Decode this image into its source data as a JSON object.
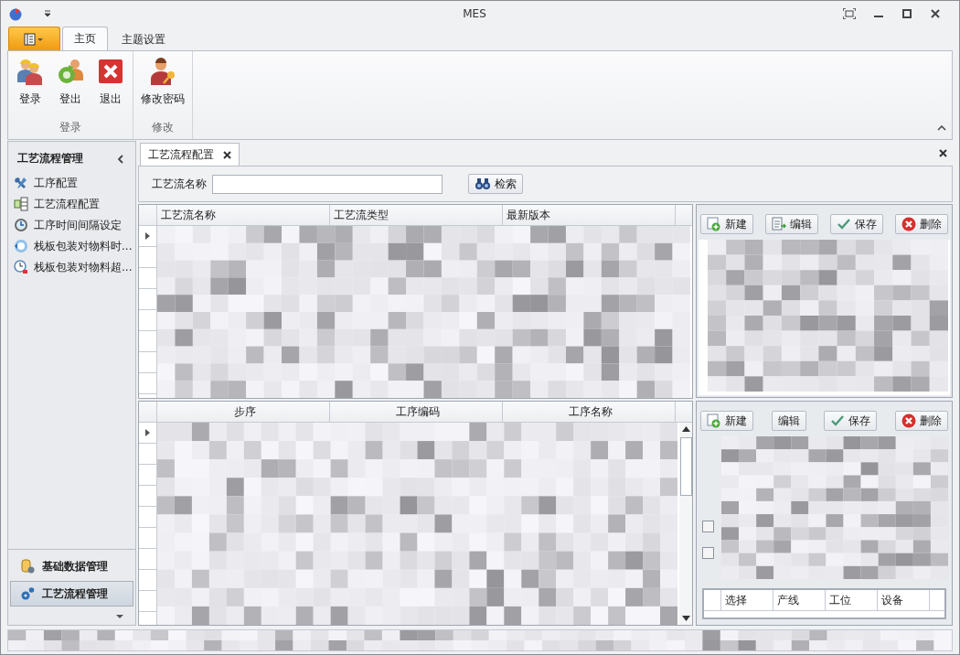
{
  "window": {
    "title": "MES"
  },
  "ribbon": {
    "tabs": [
      {
        "label": "主页",
        "selected": true
      },
      {
        "label": "主题设置",
        "selected": false
      }
    ],
    "groups": [
      {
        "label": "登录",
        "buttons": [
          {
            "label": "登录",
            "kind": "workers"
          },
          {
            "label": "登出",
            "kind": "logout"
          },
          {
            "label": "退出",
            "kind": "exit"
          }
        ]
      },
      {
        "label": "修改",
        "buttons": [
          {
            "label": "修改密码",
            "kind": "key"
          }
        ]
      }
    ]
  },
  "sidebar": {
    "title": "工艺流程管理",
    "items": [
      {
        "label": "工序配置",
        "kind": "tools"
      },
      {
        "label": "工艺流程配置",
        "kind": "flow"
      },
      {
        "label": "工序时间间隔设定",
        "kind": "alarm"
      },
      {
        "label": "栈板包装对物料时...",
        "kind": "refresh"
      },
      {
        "label": "栈板包装对物料超...",
        "kind": "clock"
      }
    ],
    "nav_groups": [
      {
        "label": "基础数据管理",
        "kind": "database",
        "selected": false
      },
      {
        "label": "工艺流程管理",
        "kind": "gears",
        "selected": true
      }
    ]
  },
  "document_tabs": [
    {
      "label": "工艺流程配置",
      "selected": true
    }
  ],
  "search": {
    "label": "工艺流名称",
    "button": "检索"
  },
  "process_grid": {
    "columns": [
      "工艺流名称",
      "工艺流类型",
      "最新版本"
    ]
  },
  "step_grid": {
    "columns": [
      "步序",
      "工序编码",
      "工序名称"
    ]
  },
  "process_toolbar": [
    {
      "label": "新建",
      "kind": "add"
    },
    {
      "label": "编辑",
      "kind": "edit"
    },
    {
      "label": "保存",
      "kind": "save"
    },
    {
      "label": "删除",
      "kind": "delete"
    }
  ],
  "step_toolbar": [
    {
      "label": "新建",
      "kind": "add"
    },
    {
      "label": "编辑",
      "kind": "plain"
    },
    {
      "label": "保存",
      "kind": "save"
    },
    {
      "label": "删除",
      "kind": "delete"
    }
  ],
  "step_form": {
    "checkboxes": [
      {
        "checked": false
      },
      {
        "checked": false
      }
    ]
  },
  "equipment_grid": {
    "columns": [
      "选择",
      "产线",
      "工位",
      "设备"
    ]
  }
}
